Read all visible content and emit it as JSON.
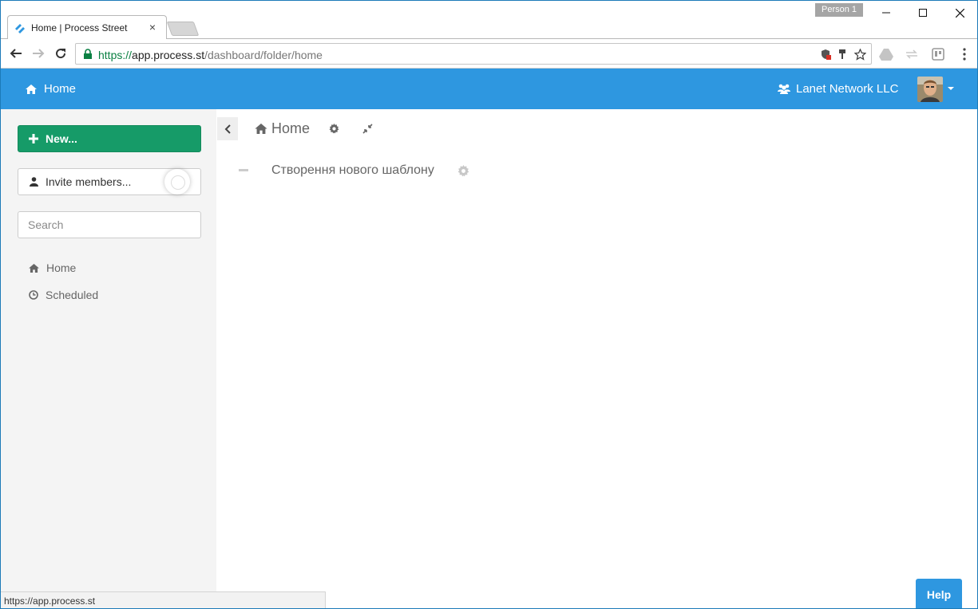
{
  "browser": {
    "profile_name": "Person 1",
    "tab_title": "Home | Process Street",
    "url": {
      "scheme": "https://",
      "host": "app.process.st",
      "path": "/dashboard/folder/home"
    },
    "status_url": "https://app.process.st"
  },
  "header": {
    "home_label": "Home",
    "organization": "Lanet Network LLC",
    "brand_color": "#2e97e0"
  },
  "sidebar": {
    "new_button": "New...",
    "invite_button": "Invite members...",
    "search_placeholder": "Search",
    "items": [
      {
        "label": "Home",
        "icon": "home-icon"
      },
      {
        "label": "Scheduled",
        "icon": "clock-icon"
      }
    ]
  },
  "main": {
    "breadcrumb": "Home",
    "templates": [
      {
        "title": "Створення нового шаблону"
      }
    ]
  },
  "help_button": "Help",
  "colors": {
    "primary": "#2e97e0",
    "success": "#169b68",
    "sidebar_bg": "#f4f4f4"
  }
}
